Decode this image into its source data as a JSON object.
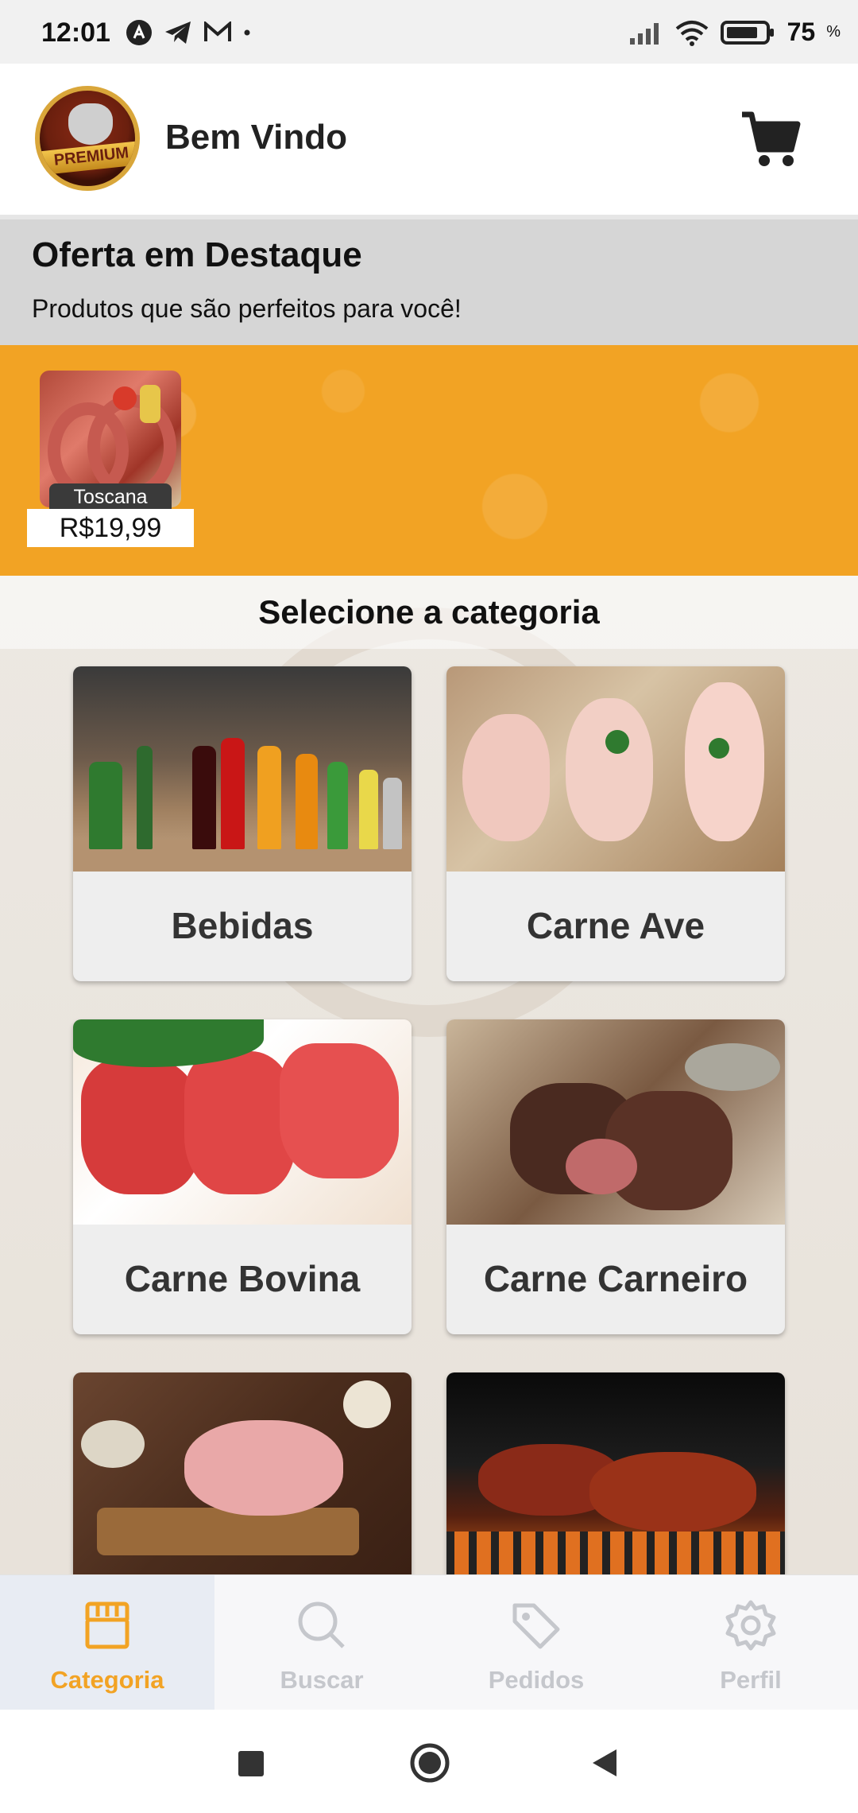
{
  "status_bar": {
    "time": "12:01",
    "battery": "75",
    "battery_unit": "%"
  },
  "header": {
    "logo_text": "PREMIUM",
    "welcome": "Bem Vindo"
  },
  "featured": {
    "title": "Oferta em Destaque",
    "subtitle": "Produtos que são perfeitos para você!"
  },
  "offer": {
    "product_name": "Toscana",
    "price": "R$19,99"
  },
  "categories": {
    "heading": "Selecione a categoria",
    "items": [
      {
        "label": "Bebidas"
      },
      {
        "label": "Carne Ave"
      },
      {
        "label": "Carne Bovina"
      },
      {
        "label": "Carne Carneiro"
      },
      {
        "label": ""
      },
      {
        "label": ""
      }
    ]
  },
  "bottom_nav": {
    "items": [
      {
        "label": "Categoria",
        "icon": "category-icon",
        "active": true
      },
      {
        "label": "Buscar",
        "icon": "search-icon",
        "active": false
      },
      {
        "label": "Pedidos",
        "icon": "tag-icon",
        "active": false
      },
      {
        "label": "Perfil",
        "icon": "gear-icon",
        "active": false
      }
    ]
  },
  "colors": {
    "accent": "#f2a324",
    "inactive": "#c5c7cc"
  }
}
